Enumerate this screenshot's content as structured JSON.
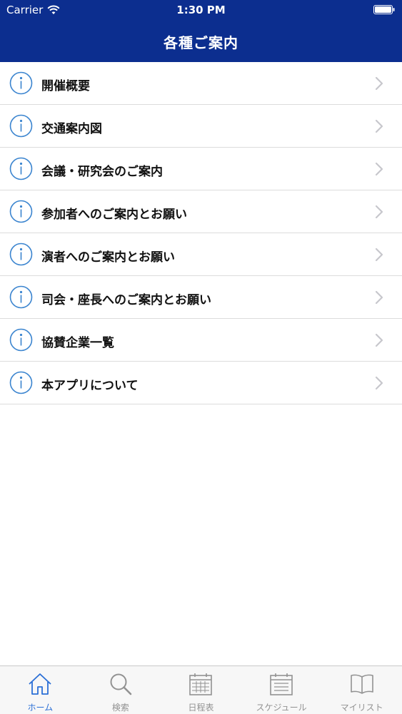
{
  "status_bar": {
    "carrier": "Carrier",
    "time": "1:30 PM"
  },
  "nav": {
    "title": "各種ご案内"
  },
  "menu": {
    "items": [
      {
        "label": "開催概要",
        "icon": "info-icon"
      },
      {
        "label": "交通案内図",
        "icon": "info-icon"
      },
      {
        "label": "会議・研究会のご案内",
        "icon": "info-icon"
      },
      {
        "label": "参加者へのご案内とお願い",
        "icon": "info-icon"
      },
      {
        "label": "演者へのご案内とお願い",
        "icon": "info-icon"
      },
      {
        "label": "司会・座長へのご案内とお願い",
        "icon": "info-icon"
      },
      {
        "label": "協賛企業一覧",
        "icon": "info-icon"
      },
      {
        "label": "本アプリについて",
        "icon": "info-icon"
      }
    ]
  },
  "tab_bar": {
    "active_index": 0,
    "tabs": [
      {
        "label": "ホーム",
        "icon": "home-icon"
      },
      {
        "label": "検索",
        "icon": "search-icon"
      },
      {
        "label": "日程表",
        "icon": "calendar-icon"
      },
      {
        "label": "スケジュール",
        "icon": "schedule-icon"
      },
      {
        "label": "マイリスト",
        "icon": "book-icon"
      }
    ]
  },
  "colors": {
    "header_bg": "#0c2e8f",
    "accent": "#2b6fd6",
    "info_icon": "#3a84cf",
    "tab_inactive": "#929292",
    "chevron": "#c7c7cc"
  }
}
